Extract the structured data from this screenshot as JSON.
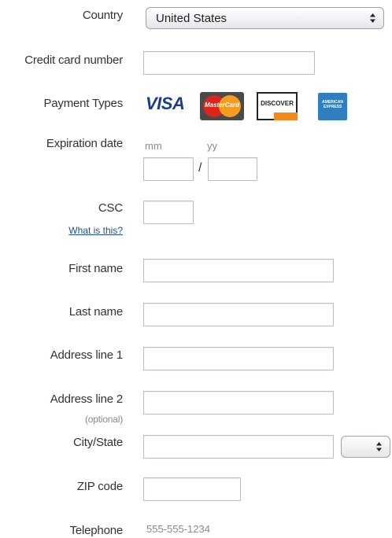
{
  "country": {
    "label": "Country",
    "value": "United States"
  },
  "credit_card": {
    "label": "Credit card number",
    "value": ""
  },
  "payment_types": {
    "label": "Payment Types",
    "visa": "VISA",
    "mastercard": "MasterCard",
    "discover": "DISCOVER",
    "amex": "AMERICAN EXPRESS"
  },
  "expiration": {
    "label": "Expiration date",
    "mm_hint": "mm",
    "yy_hint": "yy",
    "separator": "/"
  },
  "csc": {
    "label": "CSC",
    "help_link": "What is this?"
  },
  "first_name": {
    "label": "First name"
  },
  "last_name": {
    "label": "Last name"
  },
  "address1": {
    "label": "Address line 1"
  },
  "address2": {
    "label": "Address line 2",
    "note": "(optional)"
  },
  "city_state": {
    "label": "City/State",
    "state_value": ""
  },
  "zip": {
    "label": "ZIP code"
  },
  "telephone": {
    "label": "Telephone",
    "placeholder": "555-555-1234"
  },
  "colors": {
    "visa_blue": "#1a3d8f",
    "mastercard_red": "#d9251c",
    "mastercard_orange": "#f59b1e",
    "discover_orange": "#f08a1d",
    "amex_blue": "#2f7ec1",
    "link_blue": "#1a4f9c"
  },
  "icons": {
    "select_arrows": "up-down-arrows-icon"
  }
}
